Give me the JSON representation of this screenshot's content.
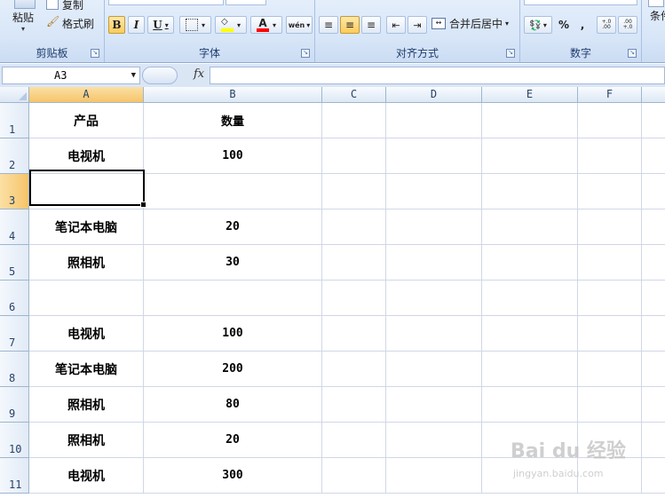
{
  "ribbon": {
    "clipboard": {
      "label": "剪贴板",
      "paste": "粘贴",
      "copy": "复制",
      "format_painter": "格式刷"
    },
    "font": {
      "label": "字体",
      "bold": "B",
      "italic": "I",
      "underline": "U",
      "font_color": "A",
      "phonetic": "wén"
    },
    "alignment": {
      "label": "对齐方式",
      "merge_center": "合并后居中"
    },
    "number": {
      "label": "数字",
      "percent": "%",
      "comma": ",",
      "inc_decimal": "+.0 .00",
      "dec_decimal": ".00 +.0"
    },
    "styles": {
      "conditional": "条件"
    }
  },
  "formula_bar": {
    "name_box": "A3",
    "fx": "fx",
    "formula": ""
  },
  "columns": [
    "A",
    "B",
    "C",
    "D",
    "E",
    "F"
  ],
  "rows": [
    {
      "num": "1",
      "a": "产品",
      "b": "数量"
    },
    {
      "num": "2",
      "a": "电视机",
      "b": "100"
    },
    {
      "num": "3",
      "a": "",
      "b": ""
    },
    {
      "num": "4",
      "a": "笔记本电脑",
      "b": "20"
    },
    {
      "num": "5",
      "a": "照相机",
      "b": "30"
    },
    {
      "num": "6",
      "a": "",
      "b": ""
    },
    {
      "num": "7",
      "a": "电视机",
      "b": "100"
    },
    {
      "num": "8",
      "a": "笔记本电脑",
      "b": "200"
    },
    {
      "num": "9",
      "a": "照相机",
      "b": "80"
    },
    {
      "num": "10",
      "a": "照相机",
      "b": "20"
    },
    {
      "num": "11",
      "a": "电视机",
      "b": "300"
    }
  ],
  "watermark": {
    "brand": "Bai du 经验",
    "url": "jingyan.baidu.com"
  }
}
